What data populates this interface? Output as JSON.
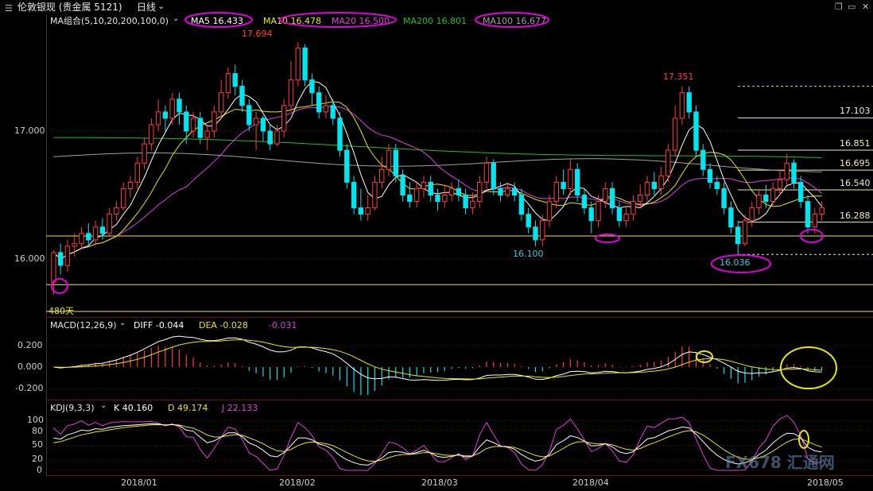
{
  "header": {
    "instrument": "伦敦银现 (贵金属 5121)",
    "period": "日线",
    "ma_label": "MA组合(5,10,20,200,100,0)",
    "ma": [
      {
        "name": "MA5",
        "value": "16.433",
        "color": "#ffffff"
      },
      {
        "name": "MA10",
        "value": "16.478",
        "color": "#e8e800"
      },
      {
        "name": "MA20",
        "value": "16.500",
        "color": "#e040e0"
      },
      {
        "name": "MA200",
        "value": "16.801",
        "color": "#20c020"
      },
      {
        "name": "MA100",
        "value": "16.677",
        "color": "#a0a0a0"
      }
    ]
  },
  "macd_header": {
    "label": "MACD(12,26,9)",
    "diff": "DIFF -0.044",
    "dea": "DEA -0.028",
    "macd": "-0.031"
  },
  "kdj_header": {
    "label": "KDJ(9,3,3)",
    "k": "K 40.160",
    "d": "D 49.174",
    "j": "J 22.133"
  },
  "price_axis": {
    "ticks": [
      "17.000",
      "16.000"
    ],
    "tick_values": [
      17.0,
      16.0
    ]
  },
  "macd_axis": {
    "ticks": [
      "0.200",
      "0.000",
      "-0.200"
    ],
    "tick_values": [
      0.2,
      0.0,
      -0.2
    ]
  },
  "kdj_axis": {
    "ticks": [
      "100",
      "80",
      "50",
      "20",
      "0"
    ],
    "tick_values": [
      100,
      80,
      50,
      20,
      0
    ]
  },
  "time_axis": {
    "labels": [
      "2018/01",
      "2018/02",
      "2018/03",
      "2018/04",
      "2018/05"
    ]
  },
  "levels": [
    "17.103",
    "16.851",
    "16.695",
    "16.540",
    "16.288"
  ],
  "annotations": {
    "high1": "17.694",
    "high2": "17.351",
    "low1": "16.100",
    "low2": "16.036",
    "days": "480天"
  },
  "watermark": "FX678 汇通网",
  "colors": {
    "up": "#ff3c3c",
    "down": "#00e5ee",
    "ma5": "#ffffff",
    "ma10": "#e8e800",
    "ma20": "#e040e0",
    "ma200": "#20c020",
    "ma100": "#a0a0a0",
    "grid": "#6a1010",
    "level": "#f0e060",
    "marker": "#e000e0",
    "marker2": "#e8e800"
  },
  "chart_data": [
    {
      "type": "candlestick",
      "title": "伦敦银现 日线",
      "x_categories": [
        "2018/01",
        "2018/02",
        "2018/03",
        "2018/04",
        "2018/05"
      ],
      "ylim": [
        15.65,
        17.95
      ],
      "candles": [
        [
          15.82,
          16.05,
          16.07,
          15.72
        ],
        [
          16.05,
          15.95,
          16.12,
          15.88
        ],
        [
          15.95,
          16.1,
          16.15,
          15.9
        ],
        [
          16.1,
          16.12,
          16.2,
          16.02
        ],
        [
          16.12,
          16.2,
          16.25,
          16.08
        ],
        [
          16.2,
          16.15,
          16.28,
          16.1
        ],
        [
          16.15,
          16.25,
          16.3,
          16.12
        ],
        [
          16.25,
          16.2,
          16.32,
          16.15
        ],
        [
          16.2,
          16.35,
          16.4,
          16.18
        ],
        [
          16.35,
          16.4,
          16.45,
          16.3
        ],
        [
          16.4,
          16.55,
          16.6,
          16.38
        ],
        [
          16.55,
          16.6,
          16.65,
          16.48
        ],
        [
          16.6,
          16.75,
          16.8,
          16.55
        ],
        [
          16.75,
          16.9,
          16.95,
          16.7
        ],
        [
          16.9,
          17.05,
          17.1,
          16.85
        ],
        [
          17.05,
          17.15,
          17.25,
          17.0
        ],
        [
          17.15,
          17.1,
          17.2,
          17.0
        ],
        [
          17.1,
          17.25,
          17.3,
          17.05
        ],
        [
          17.25,
          17.15,
          17.3,
          17.05
        ],
        [
          17.15,
          17.0,
          17.2,
          16.9
        ],
        [
          17.0,
          17.1,
          17.15,
          16.95
        ],
        [
          17.1,
          16.95,
          17.15,
          16.9
        ],
        [
          16.95,
          17.0,
          17.05,
          16.85
        ],
        [
          17.0,
          17.15,
          17.2,
          16.95
        ],
        [
          17.15,
          17.3,
          17.4,
          17.1
        ],
        [
          17.3,
          17.45,
          17.5,
          17.25
        ],
        [
          17.45,
          17.35,
          17.52,
          17.28
        ],
        [
          17.35,
          17.2,
          17.4,
          17.15
        ],
        [
          17.2,
          17.05,
          17.25,
          17.0
        ],
        [
          17.05,
          17.1,
          17.15,
          16.85
        ],
        [
          17.1,
          17.0,
          17.12,
          16.92
        ],
        [
          17.0,
          16.9,
          17.05,
          16.85
        ],
        [
          16.9,
          17.0,
          17.05,
          16.88
        ],
        [
          17.0,
          17.2,
          17.25,
          16.95
        ],
        [
          17.2,
          17.4,
          17.55,
          17.15
        ],
        [
          17.4,
          17.65,
          17.694,
          17.35
        ],
        [
          17.65,
          17.4,
          17.68,
          17.35
        ],
        [
          17.4,
          17.3,
          17.45,
          17.2
        ],
        [
          17.3,
          17.15,
          17.35,
          17.1
        ],
        [
          17.15,
          17.2,
          17.28,
          17.1
        ],
        [
          17.2,
          17.1,
          17.25,
          17.05
        ],
        [
          17.1,
          16.85,
          17.15,
          16.8
        ],
        [
          16.85,
          16.6,
          16.9,
          16.55
        ],
        [
          16.6,
          16.4,
          16.65,
          16.35
        ],
        [
          16.4,
          16.35,
          16.55,
          16.3
        ],
        [
          16.35,
          16.4,
          16.5,
          16.3
        ],
        [
          16.4,
          16.6,
          16.65,
          16.38
        ],
        [
          16.6,
          16.7,
          16.8,
          16.55
        ],
        [
          16.7,
          16.85,
          16.9,
          16.65
        ],
        [
          16.85,
          16.65,
          16.9,
          16.6
        ],
        [
          16.65,
          16.5,
          16.7,
          16.45
        ],
        [
          16.5,
          16.45,
          16.6,
          16.4
        ],
        [
          16.45,
          16.55,
          16.6,
          16.4
        ],
        [
          16.55,
          16.6,
          16.65,
          16.48
        ],
        [
          16.6,
          16.5,
          16.65,
          16.45
        ],
        [
          16.5,
          16.45,
          16.55,
          16.38
        ],
        [
          16.45,
          16.5,
          16.58,
          16.4
        ],
        [
          16.5,
          16.55,
          16.6,
          16.45
        ],
        [
          16.55,
          16.5,
          16.62,
          16.45
        ],
        [
          16.5,
          16.4,
          16.55,
          16.35
        ],
        [
          16.4,
          16.45,
          16.52,
          16.35
        ],
        [
          16.45,
          16.6,
          16.65,
          16.4
        ],
        [
          16.6,
          16.75,
          16.8,
          16.55
        ],
        [
          16.75,
          16.55,
          16.78,
          16.5
        ],
        [
          16.55,
          16.5,
          16.6,
          16.45
        ],
        [
          16.5,
          16.55,
          16.6,
          16.48
        ],
        [
          16.55,
          16.5,
          16.6,
          16.45
        ],
        [
          16.5,
          16.35,
          16.55,
          16.3
        ],
        [
          16.35,
          16.25,
          16.4,
          16.2
        ],
        [
          16.25,
          16.15,
          16.3,
          16.1
        ],
        [
          16.15,
          16.3,
          16.35,
          16.1
        ],
        [
          16.3,
          16.45,
          16.5,
          16.25
        ],
        [
          16.45,
          16.6,
          16.65,
          16.4
        ],
        [
          16.6,
          16.55,
          16.7,
          16.5
        ],
        [
          16.55,
          16.7,
          16.78,
          16.5
        ],
        [
          16.7,
          16.5,
          16.75,
          16.45
        ],
        [
          16.5,
          16.4,
          16.55,
          16.35
        ],
        [
          16.4,
          16.3,
          16.45,
          16.2
        ],
        [
          16.3,
          16.45,
          16.5,
          16.25
        ],
        [
          16.45,
          16.55,
          16.6,
          16.4
        ],
        [
          16.55,
          16.4,
          16.6,
          16.35
        ],
        [
          16.4,
          16.3,
          16.45,
          16.25
        ],
        [
          16.3,
          16.35,
          16.4,
          16.25
        ],
        [
          16.35,
          16.45,
          16.5,
          16.3
        ],
        [
          16.45,
          16.5,
          16.58,
          16.4
        ],
        [
          16.5,
          16.6,
          16.65,
          16.45
        ],
        [
          16.6,
          16.55,
          16.68,
          16.5
        ],
        [
          16.55,
          16.65,
          16.72,
          16.5
        ],
        [
          16.65,
          16.85,
          16.9,
          16.6
        ],
        [
          16.85,
          17.1,
          17.2,
          16.8
        ],
        [
          17.1,
          17.3,
          17.351,
          17.05
        ],
        [
          17.3,
          17.15,
          17.35,
          17.1
        ],
        [
          17.15,
          16.85,
          17.2,
          16.8
        ],
        [
          16.85,
          16.7,
          16.9,
          16.65
        ],
        [
          16.7,
          16.6,
          16.75,
          16.55
        ],
        [
          16.6,
          16.55,
          16.65,
          16.5
        ],
        [
          16.55,
          16.4,
          16.6,
          16.35
        ],
        [
          16.4,
          16.25,
          16.45,
          16.2
        ],
        [
          16.25,
          16.12,
          16.3,
          16.036
        ],
        [
          16.12,
          16.3,
          16.35,
          16.1
        ],
        [
          16.3,
          16.4,
          16.45,
          16.25
        ],
        [
          16.4,
          16.5,
          16.55,
          16.35
        ],
        [
          16.5,
          16.45,
          16.58,
          16.4
        ],
        [
          16.45,
          16.55,
          16.6,
          16.42
        ],
        [
          16.55,
          16.62,
          16.7,
          16.5
        ],
        [
          16.62,
          16.75,
          16.82,
          16.58
        ],
        [
          16.75,
          16.6,
          16.78,
          16.55
        ],
        [
          16.6,
          16.45,
          16.65,
          16.4
        ],
        [
          16.45,
          16.25,
          16.5,
          16.2
        ],
        [
          16.25,
          16.35,
          16.4,
          16.2
        ],
        [
          16.35,
          16.4,
          16.45,
          16.3
        ]
      ],
      "levels": [
        17.103,
        16.851,
        16.695,
        16.54,
        16.288
      ],
      "annotations": [
        {
          "label": "17.694",
          "value": 17.694
        },
        {
          "label": "17.351",
          "value": 17.351
        },
        {
          "label": "16.100",
          "value": 16.1
        },
        {
          "label": "16.036",
          "value": 16.036
        }
      ]
    },
    {
      "type": "bar",
      "title": "MACD(12,26,9)",
      "ylim": [
        -0.28,
        0.28
      ]
    },
    {
      "type": "line",
      "title": "KDJ(9,3,3)",
      "ylim": [
        0,
        115
      ]
    }
  ]
}
